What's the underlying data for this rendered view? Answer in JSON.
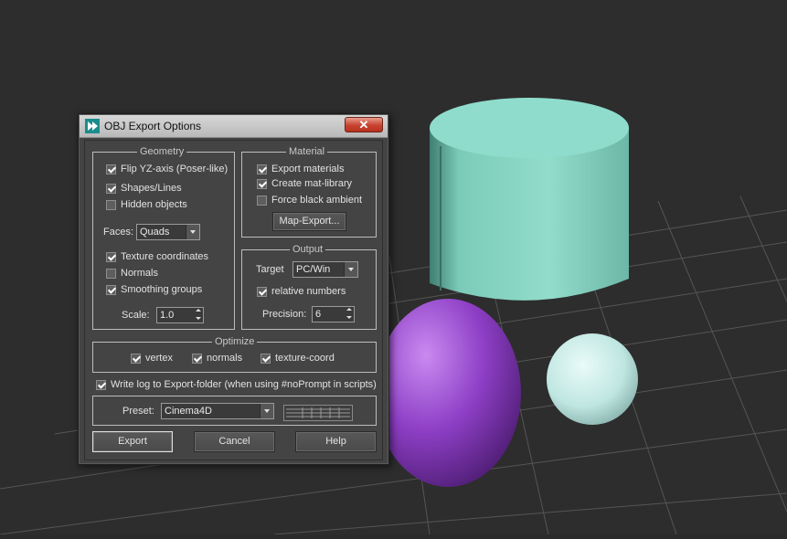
{
  "dialog": {
    "title": "OBJ Export Options",
    "close_label": "✕"
  },
  "geometry": {
    "label": "Geometry",
    "flip_yz": {
      "label": "Flip YZ-axis (Poser-like)",
      "checked": true
    },
    "shapes_lines": {
      "label": "Shapes/Lines",
      "checked": true
    },
    "hidden_objects": {
      "label": "Hidden objects",
      "checked": false
    },
    "faces_label": "Faces:",
    "faces_value": "Quads",
    "texture_coordinates": {
      "label": "Texture coordinates",
      "checked": true
    },
    "normals": {
      "label": "Normals",
      "checked": false
    },
    "smoothing_groups": {
      "label": "Smoothing groups",
      "checked": true
    },
    "scale_label": "Scale:",
    "scale_value": "1.0"
  },
  "material": {
    "label": "Material",
    "export_materials": {
      "label": "Export materials",
      "checked": true
    },
    "create_mat_library": {
      "label": "Create mat-library",
      "checked": true
    },
    "force_black_ambient": {
      "label": "Force black ambient",
      "checked": false
    },
    "map_export_label": "Map-Export..."
  },
  "output": {
    "label": "Output",
    "target_label": "Target",
    "target_value": "PC/Win",
    "relative_numbers": {
      "label": "relative numbers",
      "checked": true
    },
    "precision_label": "Precision:",
    "precision_value": "6"
  },
  "optimize": {
    "label": "Optimize",
    "vertex": {
      "label": "vertex",
      "checked": true
    },
    "normals": {
      "label": "normals",
      "checked": true
    },
    "texture_coord": {
      "label": "texture-coord",
      "checked": true
    }
  },
  "write_log": {
    "label": "Write log to Export-folder (when using #noPrompt in scripts)",
    "checked": true
  },
  "preset": {
    "label": "Preset:",
    "value": "Cinema4D"
  },
  "buttons": {
    "export": "Export",
    "cancel": "Cancel",
    "help": "Help"
  },
  "colors": {
    "cylinder": "#8cd9c8",
    "sphere_large": "#8a3fbf",
    "sphere_small": "#c9ece8",
    "viewport_bg": "#2d2d2d",
    "grid": "#5a5a5a"
  },
  "icons": {
    "title": "max-logo-icon"
  }
}
